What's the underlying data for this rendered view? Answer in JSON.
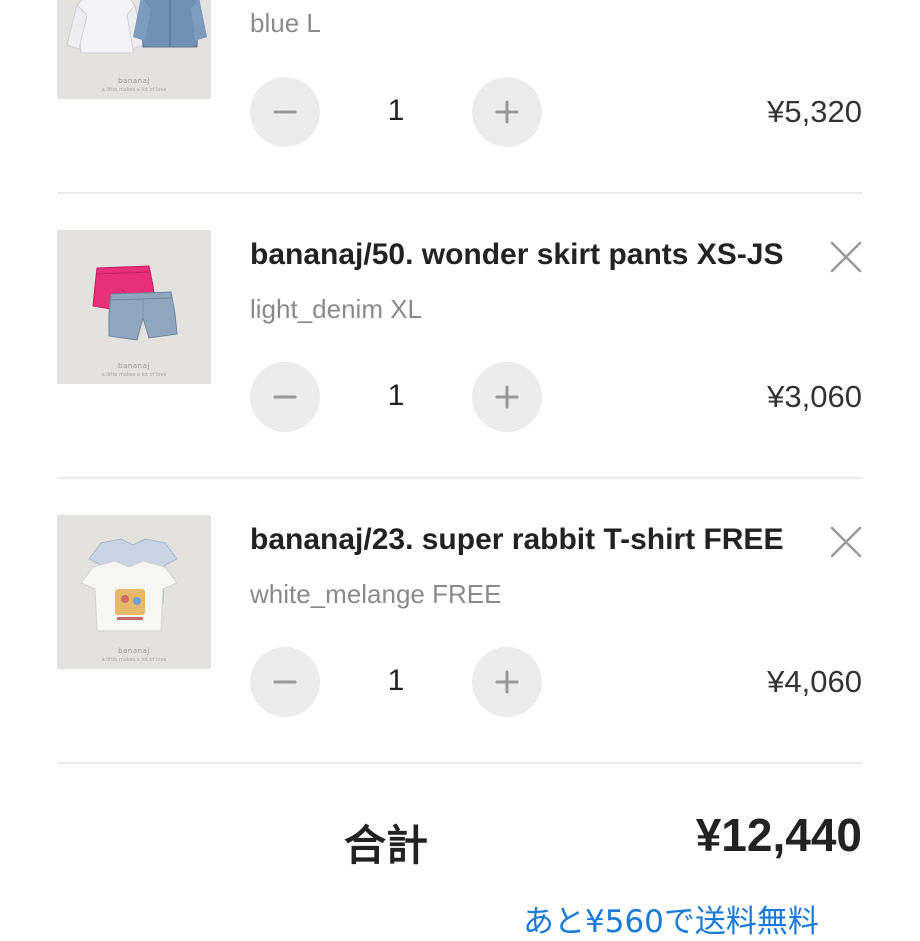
{
  "cart": {
    "items": [
      {
        "title": "",
        "variant": "blue L",
        "quantity": "1",
        "price": "¥5,320",
        "minus_icon": "minus-icon",
        "plus_icon": "plus-icon"
      },
      {
        "title": "bananaj/50. wonder skirt pants XS-JS",
        "variant": "light_denim XL",
        "quantity": "1",
        "price": "¥3,060",
        "minus_icon": "minus-icon",
        "plus_icon": "plus-icon",
        "remove_icon": "close-icon"
      },
      {
        "title": "bananaj/23. super rabbit T-shirt FREE",
        "variant": "white_melange FREE",
        "quantity": "1",
        "price": "¥4,060",
        "minus_icon": "minus-icon",
        "plus_icon": "plus-icon",
        "remove_icon": "close-icon"
      }
    ],
    "total_label": "合計",
    "total_value": "¥12,440",
    "free_shipping_message": "あと¥560で送料無料"
  },
  "colors": {
    "accent_link": "#1a7bd6",
    "stepper_bg": "#ececec",
    "thumb_bg": "#e4e2df",
    "skirt_pink": "#e8307a",
    "denim": "#8fa6be",
    "jacket_blue": "#6f8fb4"
  }
}
